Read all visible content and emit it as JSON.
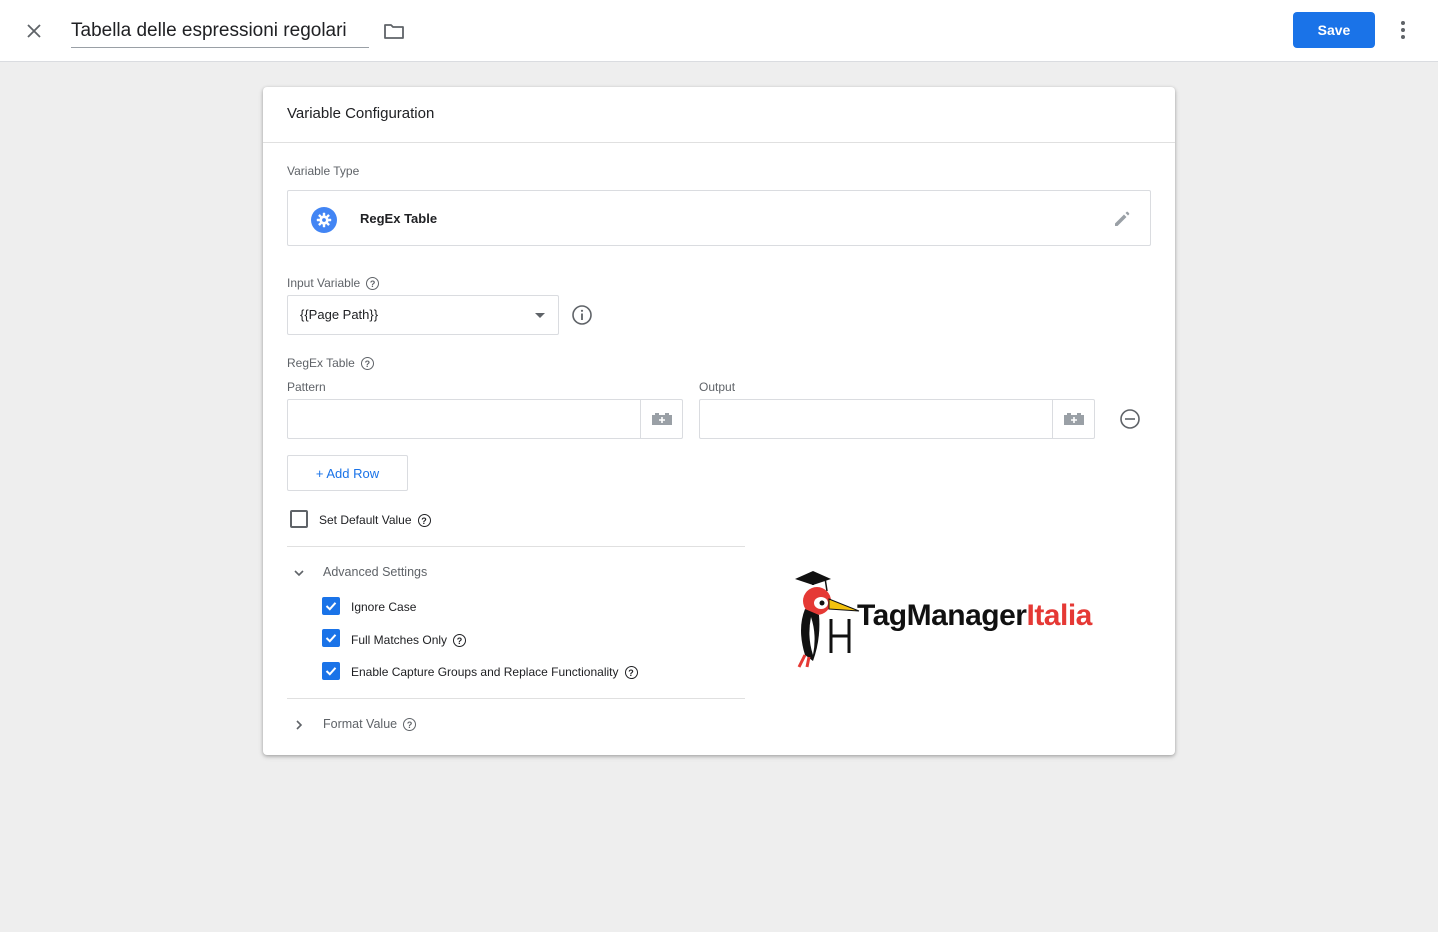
{
  "header": {
    "title": "Tabella delle espressioni regolari",
    "save_label": "Save"
  },
  "card": {
    "title": "Variable Configuration",
    "variable_type": {
      "label": "Variable Type",
      "name": "RegEx Table",
      "icon": "gear-icon"
    },
    "input_variable": {
      "label": "Input Variable",
      "value": "{{Page Path}}"
    },
    "regex_table": {
      "label": "RegEx Table",
      "pattern_label": "Pattern",
      "output_label": "Output",
      "rows": [
        {
          "pattern": "",
          "output": ""
        }
      ],
      "add_row_label": "+ Add Row"
    },
    "default_value": {
      "label": "Set Default Value",
      "checked": false
    },
    "advanced": {
      "title": "Advanced Settings",
      "expanded": true,
      "options": [
        {
          "label": "Ignore Case",
          "checked": true,
          "help": false
        },
        {
          "label": "Full Matches Only",
          "checked": true,
          "help": true
        },
        {
          "label": "Enable Capture Groups and Replace Functionality",
          "checked": true,
          "help": true
        }
      ]
    },
    "format_value": {
      "title": "Format Value",
      "expanded": false
    }
  },
  "logo": {
    "part1": "TagManager",
    "part2": "Italia"
  },
  "colors": {
    "accent": "#1a73e8",
    "background": "#eeeeee",
    "logo_red": "#e53935"
  }
}
